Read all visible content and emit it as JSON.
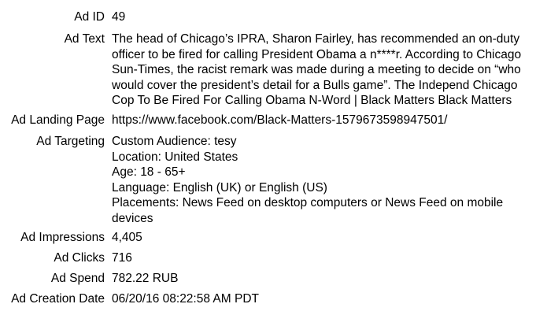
{
  "fields": {
    "ad_id": {
      "label": "Ad ID",
      "value": "49"
    },
    "ad_text": {
      "label": "Ad Text",
      "lines": [
        "The head of Chicago’s IPRA, Sharon Fairley, has recommended an on-duty",
        "officer to be fired for calling President Obama a n****r. According to Chicago",
        "Sun-Times, the racist remark was made during a meeting to decide on “who",
        "would cover the president’s detail for a Bulls game”. The Independ Chicago",
        "Cop To Be Fired For Calling Obama N-Word | Black Matters Black Matters"
      ]
    },
    "ad_landing_page": {
      "label": "Ad Landing Page",
      "value": "https://www.facebook.com/Black-Matters-1579673598947501/"
    },
    "ad_targeting": {
      "label": "Ad Targeting",
      "lines": [
        "Custom Audience: tesy",
        "Location: United States",
        "Age: 18 - 65+",
        "Language: English (UK) or English (US)",
        "Placements: News Feed on desktop computers or News Feed on mobile",
        "devices"
      ]
    },
    "ad_impressions": {
      "label": "Ad Impressions",
      "value": "4,405"
    },
    "ad_clicks": {
      "label": "Ad Clicks",
      "value": "716"
    },
    "ad_spend": {
      "label": "Ad Spend",
      "value": "782.22 RUB"
    },
    "ad_creation_date": {
      "label": "Ad Creation Date",
      "value": "06/20/16 08:22:58 AM PDT"
    }
  }
}
